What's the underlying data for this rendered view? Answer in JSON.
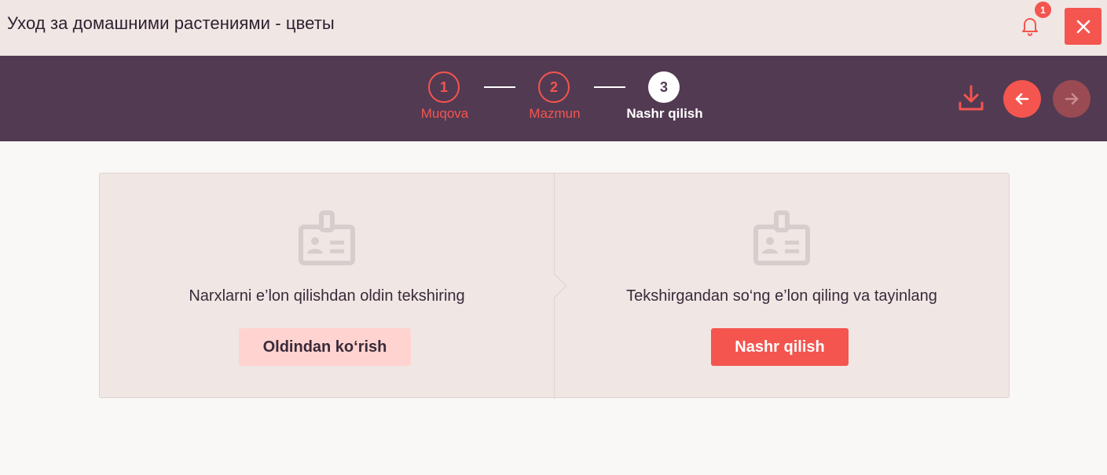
{
  "header": {
    "title": "Уход за домашними растениями - цветы",
    "notification_count": "1"
  },
  "steps": [
    {
      "number": "1",
      "label": "Muqova",
      "state": "done"
    },
    {
      "number": "2",
      "label": "Mazmun",
      "state": "done"
    },
    {
      "number": "3",
      "label": "Nashr qilish",
      "state": "active"
    }
  ],
  "toolbar": {
    "download_icon": "download-icon",
    "back_icon": "arrow-left-icon",
    "forward_icon": "arrow-right-icon"
  },
  "panels": {
    "preview": {
      "icon": "id-badge-icon",
      "text": "Narxlarni e’lon qilishdan oldin tekshiring",
      "button": "Oldindan ko‘rish"
    },
    "publish": {
      "icon": "id-badge-icon",
      "text": "Tekshirgandan so‘ng e’lon qiling va tayinlang",
      "button": "Nashr qilish"
    }
  },
  "colors": {
    "accent": "#f4554f",
    "header_bg": "#523a52",
    "topbar_bg": "#f0e6e4",
    "card_bg": "#f0e6e4",
    "preview_button_bg": "#ffd4d0"
  }
}
